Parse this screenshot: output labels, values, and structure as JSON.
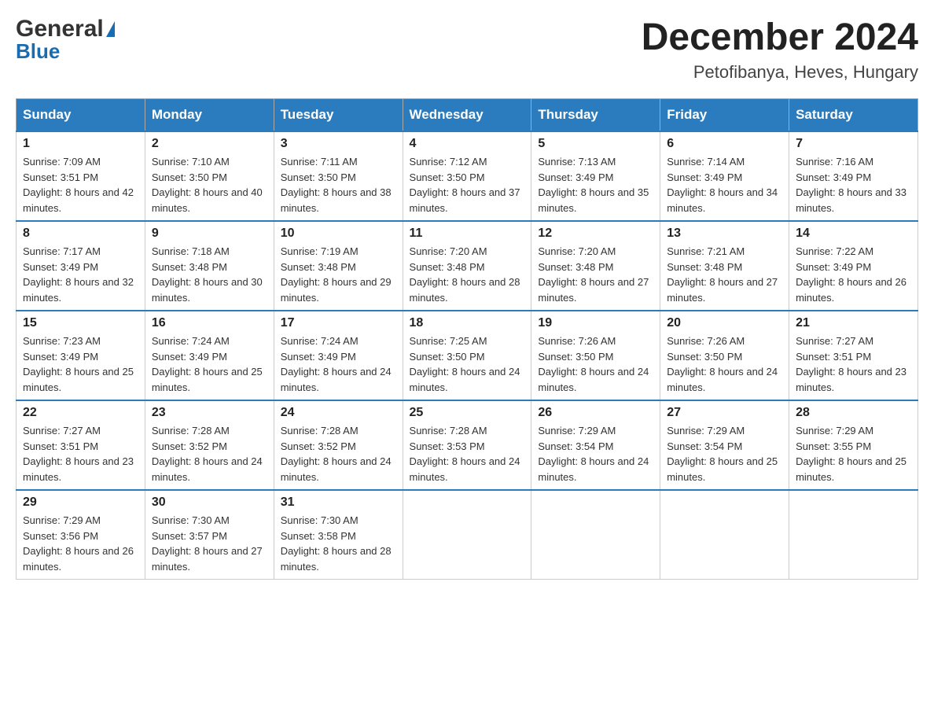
{
  "header": {
    "logo_general": "General",
    "logo_blue": "Blue",
    "main_title": "December 2024",
    "subtitle": "Petofibanya, Heves, Hungary"
  },
  "days_of_week": [
    "Sunday",
    "Monday",
    "Tuesday",
    "Wednesday",
    "Thursday",
    "Friday",
    "Saturday"
  ],
  "weeks": [
    [
      {
        "day": "1",
        "sunrise": "Sunrise: 7:09 AM",
        "sunset": "Sunset: 3:51 PM",
        "daylight": "Daylight: 8 hours and 42 minutes."
      },
      {
        "day": "2",
        "sunrise": "Sunrise: 7:10 AM",
        "sunset": "Sunset: 3:50 PM",
        "daylight": "Daylight: 8 hours and 40 minutes."
      },
      {
        "day": "3",
        "sunrise": "Sunrise: 7:11 AM",
        "sunset": "Sunset: 3:50 PM",
        "daylight": "Daylight: 8 hours and 38 minutes."
      },
      {
        "day": "4",
        "sunrise": "Sunrise: 7:12 AM",
        "sunset": "Sunset: 3:50 PM",
        "daylight": "Daylight: 8 hours and 37 minutes."
      },
      {
        "day": "5",
        "sunrise": "Sunrise: 7:13 AM",
        "sunset": "Sunset: 3:49 PM",
        "daylight": "Daylight: 8 hours and 35 minutes."
      },
      {
        "day": "6",
        "sunrise": "Sunrise: 7:14 AM",
        "sunset": "Sunset: 3:49 PM",
        "daylight": "Daylight: 8 hours and 34 minutes."
      },
      {
        "day": "7",
        "sunrise": "Sunrise: 7:16 AM",
        "sunset": "Sunset: 3:49 PM",
        "daylight": "Daylight: 8 hours and 33 minutes."
      }
    ],
    [
      {
        "day": "8",
        "sunrise": "Sunrise: 7:17 AM",
        "sunset": "Sunset: 3:49 PM",
        "daylight": "Daylight: 8 hours and 32 minutes."
      },
      {
        "day": "9",
        "sunrise": "Sunrise: 7:18 AM",
        "sunset": "Sunset: 3:48 PM",
        "daylight": "Daylight: 8 hours and 30 minutes."
      },
      {
        "day": "10",
        "sunrise": "Sunrise: 7:19 AM",
        "sunset": "Sunset: 3:48 PM",
        "daylight": "Daylight: 8 hours and 29 minutes."
      },
      {
        "day": "11",
        "sunrise": "Sunrise: 7:20 AM",
        "sunset": "Sunset: 3:48 PM",
        "daylight": "Daylight: 8 hours and 28 minutes."
      },
      {
        "day": "12",
        "sunrise": "Sunrise: 7:20 AM",
        "sunset": "Sunset: 3:48 PM",
        "daylight": "Daylight: 8 hours and 27 minutes."
      },
      {
        "day": "13",
        "sunrise": "Sunrise: 7:21 AM",
        "sunset": "Sunset: 3:48 PM",
        "daylight": "Daylight: 8 hours and 27 minutes."
      },
      {
        "day": "14",
        "sunrise": "Sunrise: 7:22 AM",
        "sunset": "Sunset: 3:49 PM",
        "daylight": "Daylight: 8 hours and 26 minutes."
      }
    ],
    [
      {
        "day": "15",
        "sunrise": "Sunrise: 7:23 AM",
        "sunset": "Sunset: 3:49 PM",
        "daylight": "Daylight: 8 hours and 25 minutes."
      },
      {
        "day": "16",
        "sunrise": "Sunrise: 7:24 AM",
        "sunset": "Sunset: 3:49 PM",
        "daylight": "Daylight: 8 hours and 25 minutes."
      },
      {
        "day": "17",
        "sunrise": "Sunrise: 7:24 AM",
        "sunset": "Sunset: 3:49 PM",
        "daylight": "Daylight: 8 hours and 24 minutes."
      },
      {
        "day": "18",
        "sunrise": "Sunrise: 7:25 AM",
        "sunset": "Sunset: 3:50 PM",
        "daylight": "Daylight: 8 hours and 24 minutes."
      },
      {
        "day": "19",
        "sunrise": "Sunrise: 7:26 AM",
        "sunset": "Sunset: 3:50 PM",
        "daylight": "Daylight: 8 hours and 24 minutes."
      },
      {
        "day": "20",
        "sunrise": "Sunrise: 7:26 AM",
        "sunset": "Sunset: 3:50 PM",
        "daylight": "Daylight: 8 hours and 24 minutes."
      },
      {
        "day": "21",
        "sunrise": "Sunrise: 7:27 AM",
        "sunset": "Sunset: 3:51 PM",
        "daylight": "Daylight: 8 hours and 23 minutes."
      }
    ],
    [
      {
        "day": "22",
        "sunrise": "Sunrise: 7:27 AM",
        "sunset": "Sunset: 3:51 PM",
        "daylight": "Daylight: 8 hours and 23 minutes."
      },
      {
        "day": "23",
        "sunrise": "Sunrise: 7:28 AM",
        "sunset": "Sunset: 3:52 PM",
        "daylight": "Daylight: 8 hours and 24 minutes."
      },
      {
        "day": "24",
        "sunrise": "Sunrise: 7:28 AM",
        "sunset": "Sunset: 3:52 PM",
        "daylight": "Daylight: 8 hours and 24 minutes."
      },
      {
        "day": "25",
        "sunrise": "Sunrise: 7:28 AM",
        "sunset": "Sunset: 3:53 PM",
        "daylight": "Daylight: 8 hours and 24 minutes."
      },
      {
        "day": "26",
        "sunrise": "Sunrise: 7:29 AM",
        "sunset": "Sunset: 3:54 PM",
        "daylight": "Daylight: 8 hours and 24 minutes."
      },
      {
        "day": "27",
        "sunrise": "Sunrise: 7:29 AM",
        "sunset": "Sunset: 3:54 PM",
        "daylight": "Daylight: 8 hours and 25 minutes."
      },
      {
        "day": "28",
        "sunrise": "Sunrise: 7:29 AM",
        "sunset": "Sunset: 3:55 PM",
        "daylight": "Daylight: 8 hours and 25 minutes."
      }
    ],
    [
      {
        "day": "29",
        "sunrise": "Sunrise: 7:29 AM",
        "sunset": "Sunset: 3:56 PM",
        "daylight": "Daylight: 8 hours and 26 minutes."
      },
      {
        "day": "30",
        "sunrise": "Sunrise: 7:30 AM",
        "sunset": "Sunset: 3:57 PM",
        "daylight": "Daylight: 8 hours and 27 minutes."
      },
      {
        "day": "31",
        "sunrise": "Sunrise: 7:30 AM",
        "sunset": "Sunset: 3:58 PM",
        "daylight": "Daylight: 8 hours and 28 minutes."
      },
      null,
      null,
      null,
      null
    ]
  ]
}
